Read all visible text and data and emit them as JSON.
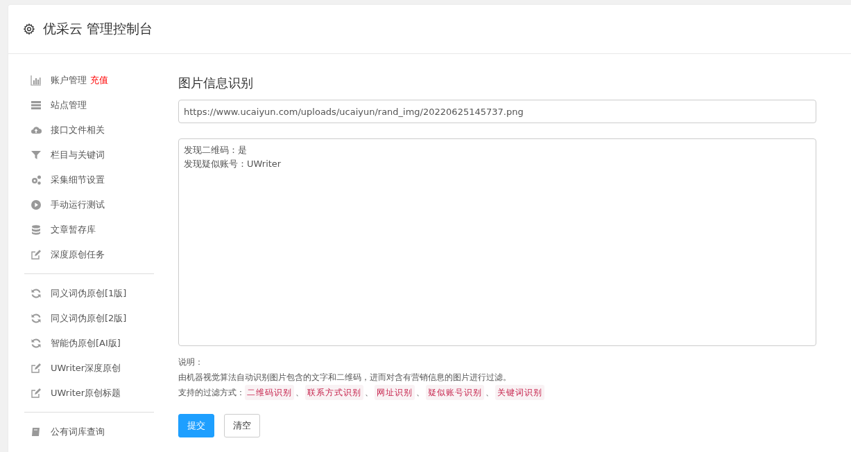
{
  "header": {
    "title": "优采云 管理控制台"
  },
  "sidebar": {
    "groups": [
      [
        {
          "label": "账户管理",
          "badge": "充值"
        },
        {
          "label": "站点管理"
        },
        {
          "label": "接口文件相关"
        },
        {
          "label": "栏目与关键词"
        },
        {
          "label": "采集细节设置"
        },
        {
          "label": "手动运行测试"
        },
        {
          "label": "文章暂存库"
        },
        {
          "label": "深度原创任务"
        }
      ],
      [
        {
          "label": "同义词伪原创[1版]"
        },
        {
          "label": "同义词伪原创[2版]"
        },
        {
          "label": "智能伪原创[AI版]"
        },
        {
          "label": "UWriter深度原创"
        },
        {
          "label": "UWriter原创标题"
        }
      ],
      [
        {
          "label": "公有词库查询"
        }
      ]
    ]
  },
  "main": {
    "title": "图片信息识别",
    "url_field": {
      "value": "https://www.ucaiyun.com/uploads/ucaiyun/rand_img/20220625145737.png"
    },
    "result_box": {
      "lines": [
        "发现二维码：是",
        "发现疑似账号：UWriter"
      ]
    },
    "notes": {
      "heading": "说明：",
      "description": "由机器视觉算法自动识别图片包含的文字和二维码，进而对含有营销信息的图片进行过滤。",
      "methods_label": "支持的过滤方式：",
      "separator": "、",
      "methods": [
        "二维码识别",
        "联系方式识别",
        "网址识别",
        "疑似账号识别",
        "关键词识别"
      ]
    },
    "buttons": [
      {
        "label": "提交",
        "kind": "primary"
      },
      {
        "label": "清空",
        "kind": "default"
      }
    ]
  }
}
